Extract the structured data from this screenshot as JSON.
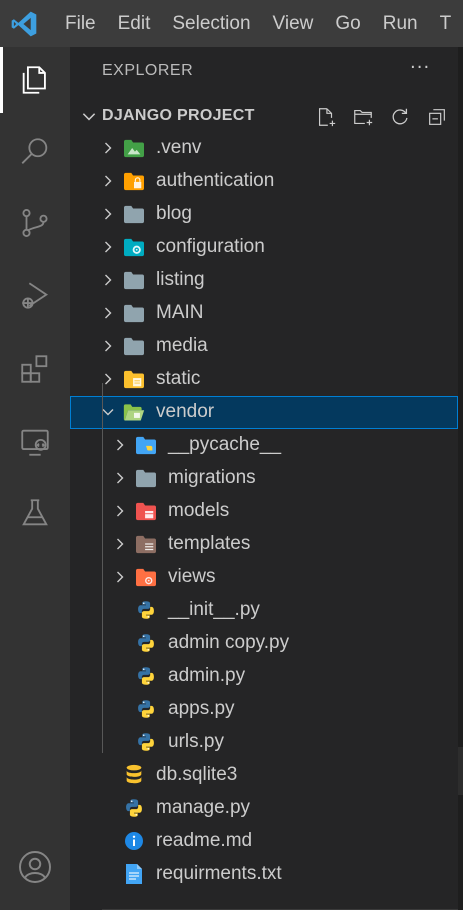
{
  "menu": [
    "File",
    "Edit",
    "Selection",
    "View",
    "Go",
    "Run",
    "T"
  ],
  "activity_bar": {
    "items": [
      "explorer-icon",
      "search-icon",
      "source-control-icon",
      "run-debug-icon",
      "extensions-icon",
      "remote-explorer-icon",
      "testing-icon"
    ],
    "bottom": "accounts-icon"
  },
  "explorer": {
    "header": "EXPLORER",
    "more": "···",
    "section_title": "DJANGO PROJECT",
    "actions": [
      "new-file-icon",
      "new-folder-icon",
      "refresh-icon",
      "collapse-all-icon"
    ]
  },
  "tree": [
    {
      "name": ".venv",
      "kind": "folder",
      "icon": "folder-venv-icon",
      "depth": 0,
      "expanded": false
    },
    {
      "name": "authentication",
      "kind": "folder",
      "icon": "folder-lock-icon",
      "depth": 0,
      "expanded": false
    },
    {
      "name": "blog",
      "kind": "folder",
      "icon": "folder-icon",
      "depth": 0,
      "expanded": false
    },
    {
      "name": "configuration",
      "kind": "folder",
      "icon": "folder-config-icon",
      "depth": 0,
      "expanded": false
    },
    {
      "name": "listing",
      "kind": "folder",
      "icon": "folder-icon",
      "depth": 0,
      "expanded": false
    },
    {
      "name": "MAIN",
      "kind": "folder",
      "icon": "folder-icon",
      "depth": 0,
      "expanded": false
    },
    {
      "name": "media",
      "kind": "folder",
      "icon": "folder-icon",
      "depth": 0,
      "expanded": false
    },
    {
      "name": "static",
      "kind": "folder",
      "icon": "folder-static-icon",
      "depth": 0,
      "expanded": false
    },
    {
      "name": "vendor",
      "kind": "folder",
      "icon": "folder-open-vendor-icon",
      "depth": 0,
      "expanded": true,
      "selected": true
    },
    {
      "name": "__pycache__",
      "kind": "folder",
      "icon": "folder-python-icon",
      "depth": 1,
      "expanded": false
    },
    {
      "name": "migrations",
      "kind": "folder",
      "icon": "folder-icon",
      "depth": 1,
      "expanded": false
    },
    {
      "name": "models",
      "kind": "folder",
      "icon": "folder-models-icon",
      "depth": 1,
      "expanded": false
    },
    {
      "name": "templates",
      "kind": "folder",
      "icon": "folder-templates-icon",
      "depth": 1,
      "expanded": false
    },
    {
      "name": "views",
      "kind": "folder",
      "icon": "folder-views-icon",
      "depth": 1,
      "expanded": false
    },
    {
      "name": "__init__.py",
      "kind": "file",
      "icon": "python-file-icon",
      "depth": 1
    },
    {
      "name": "admin copy.py",
      "kind": "file",
      "icon": "python-file-icon",
      "depth": 1
    },
    {
      "name": "admin.py",
      "kind": "file",
      "icon": "python-file-icon",
      "depth": 1
    },
    {
      "name": "apps.py",
      "kind": "file",
      "icon": "python-file-icon",
      "depth": 1
    },
    {
      "name": "urls.py",
      "kind": "file",
      "icon": "python-file-icon",
      "depth": 1
    },
    {
      "name": "db.sqlite3",
      "kind": "file",
      "icon": "database-icon",
      "depth": 0
    },
    {
      "name": "manage.py",
      "kind": "file",
      "icon": "python-file-icon",
      "depth": 0
    },
    {
      "name": "readme.md",
      "kind": "file",
      "icon": "info-icon",
      "depth": 0
    },
    {
      "name": "requirments.txt",
      "kind": "file",
      "icon": "text-file-icon",
      "depth": 0
    }
  ],
  "colors": {
    "accent": "#007acc",
    "folder": "#90a4ae",
    "python_blue": "#3572a5",
    "python_yellow": "#ffd43b",
    "database": "#f9c22e",
    "info": "#1e88e5",
    "text_file": "#42a5f5"
  }
}
